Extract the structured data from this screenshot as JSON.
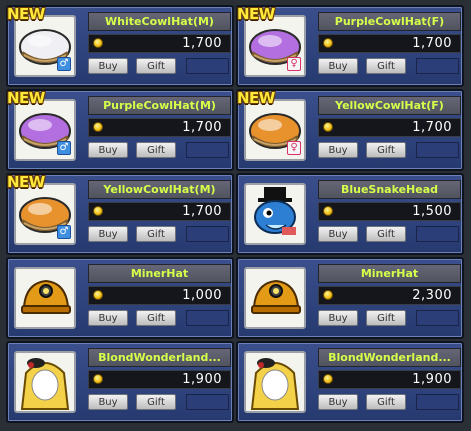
{
  "items": [
    {
      "name": "WhiteCowlHat(M)",
      "price": "1,700",
      "new": true,
      "new_label": "NEW",
      "buy": "Buy",
      "gift": "Gift",
      "icon": "white-cowl-hat-icon",
      "color": "#f0f0f4",
      "gender": "m"
    },
    {
      "name": "PurpleCowlHat(F)",
      "price": "1,700",
      "new": true,
      "new_label": "NEW",
      "buy": "Buy",
      "gift": "Gift",
      "icon": "purple-cowl-hat-icon",
      "color": "#b36ee0",
      "gender": "f"
    },
    {
      "name": "PurpleCowlHat(M)",
      "price": "1,700",
      "new": true,
      "new_label": "NEW",
      "buy": "Buy",
      "gift": "Gift",
      "icon": "purple-cowl-hat-icon",
      "color": "#b36ee0",
      "gender": "m"
    },
    {
      "name": "YellowCowlHat(F)",
      "price": "1,700",
      "new": true,
      "new_label": "NEW",
      "buy": "Buy",
      "gift": "Gift",
      "icon": "yellow-cowl-hat-icon",
      "color": "#e8922e",
      "gender": "f"
    },
    {
      "name": "YellowCowlHat(M)",
      "price": "1,700",
      "new": true,
      "new_label": "NEW",
      "buy": "Buy",
      "gift": "Gift",
      "icon": "yellow-cowl-hat-icon",
      "color": "#e8922e",
      "gender": "m"
    },
    {
      "name": "BlueSnakeHead",
      "price": "1,500",
      "new": false,
      "buy": "Buy",
      "gift": "Gift",
      "icon": "blue-snake-head-icon",
      "color": "#2d7fd4",
      "gender": ""
    },
    {
      "name": "MinerHat",
      "price": "1,000",
      "new": false,
      "buy": "Buy",
      "gift": "Gift",
      "icon": "miner-hat-icon",
      "color": "#e39a16",
      "gender": ""
    },
    {
      "name": "MinerHat",
      "price": "2,300",
      "new": false,
      "buy": "Buy",
      "gift": "Gift",
      "icon": "miner-hat-icon",
      "color": "#e39a16",
      "gender": ""
    },
    {
      "name": "BlondWonderland...",
      "price": "1,900",
      "new": false,
      "buy": "Buy",
      "gift": "Gift",
      "icon": "blond-wonderland-hair-icon",
      "color": "#f3d24a",
      "gender": ""
    },
    {
      "name": "BlondWonderland...",
      "price": "1,900",
      "new": false,
      "buy": "Buy",
      "gift": "Gift",
      "icon": "blond-wonderland-hair-icon",
      "color": "#f3d24a",
      "gender": ""
    }
  ],
  "colors": {
    "card_bg": "#2f4580",
    "name_text": "#d6ff4a",
    "price_text": "#ffffff",
    "new_badge": "#ffe93a",
    "coin": "#f3c21a"
  }
}
